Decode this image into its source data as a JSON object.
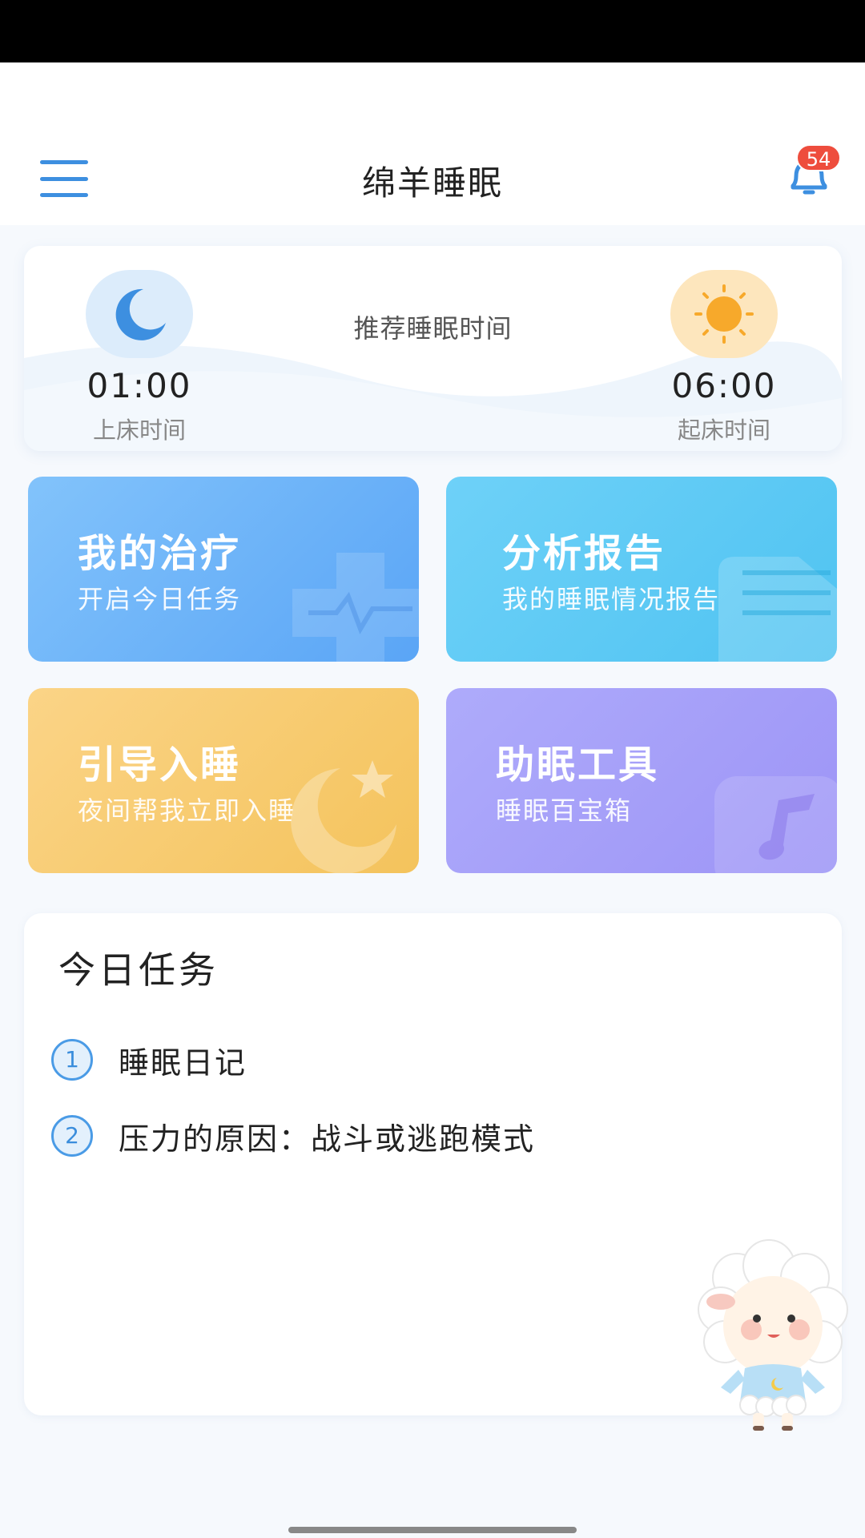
{
  "header": {
    "title": "绵羊睡眠",
    "notification_count": "54"
  },
  "sleep_card": {
    "recommend_label": "推荐睡眠时间",
    "bedtime": {
      "time": "01:00",
      "label": "上床时间"
    },
    "waketime": {
      "time": "06:00",
      "label": "起床时间"
    }
  },
  "features": [
    {
      "title": "我的治疗",
      "subtitle": "开启今日任务"
    },
    {
      "title": "分析报告",
      "subtitle": "我的睡眠情况报告"
    },
    {
      "title": "引导入睡",
      "subtitle": "夜间帮我立即入睡"
    },
    {
      "title": "助眠工具",
      "subtitle": "睡眠百宝箱"
    }
  ],
  "tasks": {
    "title": "今日任务",
    "items": [
      {
        "num": "1",
        "text": "睡眠日记"
      },
      {
        "num": "2",
        "text": "压力的原因：战斗或逃跑模式"
      }
    ]
  },
  "colors": {
    "accent": "#3d8fe0",
    "badge": "#ee4d3d",
    "treatment": "#5aa5f6",
    "report": "#4fc3f1",
    "guide": "#f4c35c",
    "tools": "#9d94f6"
  },
  "icons": {
    "menu": "menu-icon",
    "bell": "bell-icon",
    "moon": "moon-icon",
    "sun": "sun-icon"
  }
}
